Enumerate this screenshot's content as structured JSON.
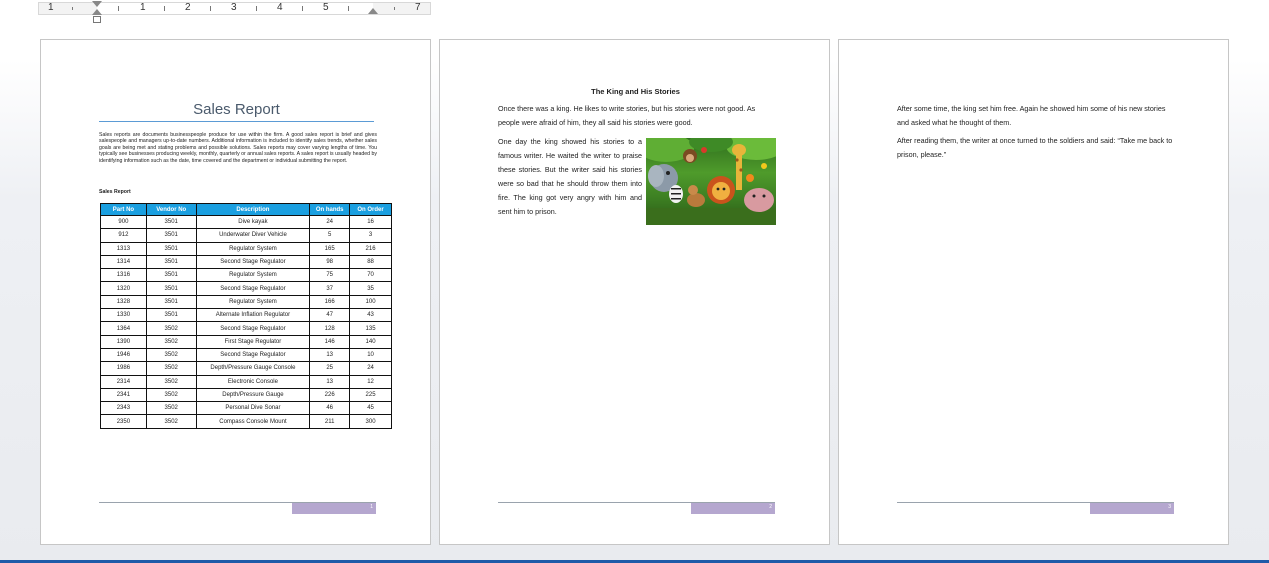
{
  "ruler": {
    "numbers": [
      "1",
      "1",
      "2",
      "3",
      "4",
      "5",
      "7"
    ]
  },
  "page1": {
    "title": "Sales Report",
    "intro": "Sales reports are documents businesspeople produce for use within the firm. A good sales report is brief and gives salespeople and managers up-to-date numbers. Additional information is included to identify sales trends, whether sales goals are being met and stating problems and possible solutions. Sales reports may cover varying lengths of time. You typically see businesses producing weekly, monthly, quarterly or annual sales reports. A sales report is usually headed by identifying information such as the date, time covered and the department or individual submitting the report.",
    "table_caption": "Sales Report",
    "table": {
      "headers": [
        "Part No",
        "Vendor No",
        "Description",
        "On hands",
        "On Order"
      ],
      "rows": [
        [
          "900",
          "3501",
          "Dive kayak",
          "24",
          "16"
        ],
        [
          "912",
          "3501",
          "Underwater Diver Vehicle",
          "5",
          "3"
        ],
        [
          "1313",
          "3501",
          "Regulator System",
          "165",
          "216"
        ],
        [
          "1314",
          "3501",
          "Second Stage Regulator",
          "98",
          "88"
        ],
        [
          "1316",
          "3501",
          "Regulator System",
          "75",
          "70"
        ],
        [
          "1320",
          "3501",
          "Second Stage Regulator",
          "37",
          "35"
        ],
        [
          "1328",
          "3501",
          "Regulator System",
          "166",
          "100"
        ],
        [
          "1330",
          "3501",
          "Alternate Inflation Regulator",
          "47",
          "43"
        ],
        [
          "1364",
          "3502",
          "Second Stage Regulator",
          "128",
          "135"
        ],
        [
          "1390",
          "3502",
          "First Stage Regulator",
          "146",
          "140"
        ],
        [
          "1946",
          "3502",
          "Second Stage Regulator",
          "13",
          "10"
        ],
        [
          "1986",
          "3502",
          "Depth/Pressure Gauge Console",
          "25",
          "24"
        ],
        [
          "2314",
          "3502",
          "Electronic Console",
          "13",
          "12"
        ],
        [
          "2341",
          "3502",
          "Depth/Pressure Gauge",
          "226",
          "225"
        ],
        [
          "2343",
          "3502",
          "Personal Dive Sonar",
          "46",
          "45"
        ],
        [
          "2350",
          "3502",
          "Compass Console Mount",
          "211",
          "300"
        ]
      ]
    },
    "page_number": "1"
  },
  "page2": {
    "title": "The King and His Stories",
    "para1": "Once there was a king. He likes to write stories, but his stories were not good. As people were afraid of him, they all said his stories were good.",
    "para2": "One day the king showed his stories to a famous writer. He waited the writer to praise these stories. But the writer said his stories were so bad that he should throw them into fire. The king got very angry with him and sent him to prison.",
    "image_alt": "jungle animals illustration",
    "page_number": "2"
  },
  "page3": {
    "para1": "After some time, the king set him free. Again he showed him some of his new stories and asked what he thought of them.",
    "para2": "After reading them, the writer at once turned to the soldiers and said: “Take me back to prison, please.”",
    "page_number": "3"
  },
  "colors": {
    "table_header": "#1a9fe0",
    "footer_accent": "#b5a7cf",
    "title_rule": "#5b9bd5"
  }
}
